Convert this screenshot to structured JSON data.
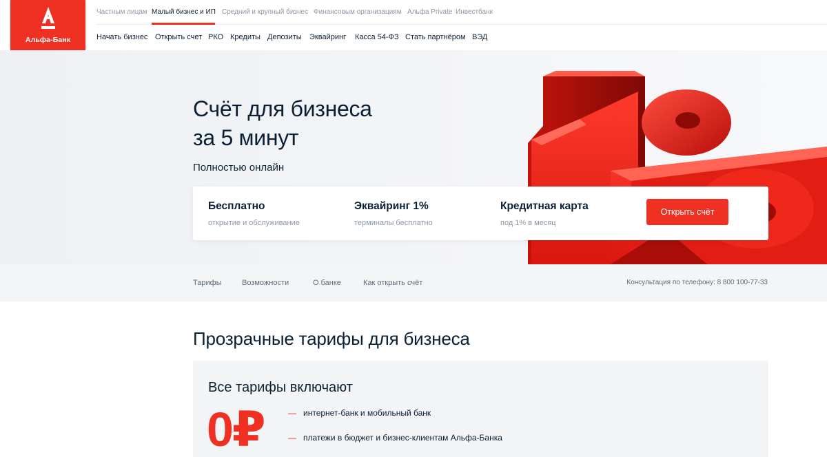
{
  "brand": {
    "name": "Альфа-Банк",
    "color": "#ef3124"
  },
  "top_nav": [
    {
      "label": "Частным лицам"
    },
    {
      "label": "Малый бизнес и ИП",
      "active": true
    },
    {
      "label": "Средний и крупный бизнес"
    },
    {
      "label": "Финансовым организациям"
    },
    {
      "label": "Альфа Private"
    },
    {
      "label": "Инвестбанк"
    }
  ],
  "sub_nav": [
    {
      "label": "Начать бизнес"
    },
    {
      "label": "Открыть счет"
    },
    {
      "label": "РКО"
    },
    {
      "label": "Кредиты"
    },
    {
      "label": "Депозиты"
    },
    {
      "label": "Эквайринг"
    },
    {
      "label": "Касса 54-ФЗ"
    },
    {
      "label": "Стать партнёром"
    },
    {
      "label": "ВЭД"
    }
  ],
  "hero": {
    "title_line1": "Счёт для бизнеса",
    "title_line2": "за 5 минут",
    "subtitle": "Полностью онлайн",
    "features": [
      {
        "title": "Бесплатно",
        "desc": "открытие и обслуживание"
      },
      {
        "title": "Эквайринг 1%",
        "desc": "терминалы бесплатно"
      },
      {
        "title": "Кредитная карта",
        "desc": "под 1% в месяц"
      }
    ],
    "cta_label": "Открыть счёт"
  },
  "page_nav": {
    "links": [
      {
        "label": "Тарифы"
      },
      {
        "label": "Возможности"
      },
      {
        "label": "О банке"
      },
      {
        "label": "Как открыть счёт"
      }
    ],
    "phone_text": "Консультация по телефону: 8 800 100-77-33"
  },
  "tariffs": {
    "section_title": "Прозрачные тарифы для бизнеса",
    "box_title": "Все тарифы включают",
    "price": "0₽",
    "items": [
      {
        "text": "интернет-банк и мобильный банк"
      },
      {
        "text": "платежи в бюджет и бизнес-клиентам Альфа-Банка"
      }
    ]
  }
}
